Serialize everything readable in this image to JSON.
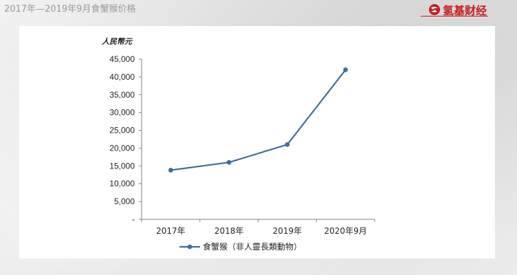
{
  "header": {
    "title": "2017年—2019年9月食蟹猴价格",
    "brand_name": "氢基财经",
    "brand_color": "#c61a1f"
  },
  "chart_data": {
    "type": "line",
    "title": "",
    "ylabel": "人民幣元",
    "xlabel": "",
    "categories": [
      "2017年",
      "2018年",
      "2019年",
      "2020年9月"
    ],
    "series": [
      {
        "name": "食蟹猴（非人靈長類動物）",
        "values": [
          13800,
          16000,
          21000,
          42000
        ],
        "color": "#3f6d9b"
      }
    ],
    "ylim": [
      0,
      45000
    ],
    "yticks": [
      0,
      5000,
      10000,
      15000,
      20000,
      25000,
      30000,
      35000,
      40000,
      45000
    ],
    "ytick_labels": [
      "-",
      "5,000",
      "10,000",
      "15,000",
      "20,000",
      "25,000",
      "30,000",
      "35,000",
      "40,000",
      "45,000"
    ],
    "grid": false,
    "legend": "bottom-center"
  }
}
